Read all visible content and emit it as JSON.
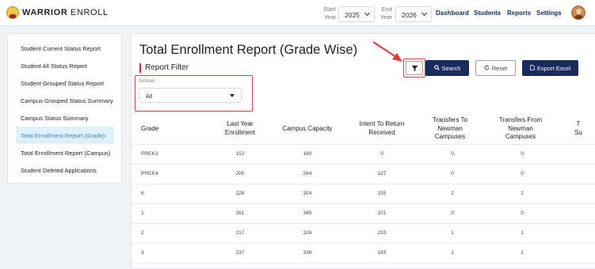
{
  "brand": {
    "bold": "WARRIOR",
    "rest": " ENROLL"
  },
  "year_filter": {
    "start_label_1": "Start",
    "start_label_2": "Year",
    "start_value": "2025",
    "end_label_1": "End",
    "end_label_2": "Year",
    "end_value": "2026"
  },
  "nav": [
    "Dashboard",
    "Students",
    "Reports",
    "Settings"
  ],
  "sidebar": {
    "items": [
      {
        "label": "Student Current Status Report"
      },
      {
        "label": "Student All Status Report"
      },
      {
        "label": "Student Grouped Status Report"
      },
      {
        "label": "Campus Grouped Status Summary"
      },
      {
        "label": "Campus Status Summary"
      },
      {
        "label": "Total Enrollment Report (Grade)",
        "active": true
      },
      {
        "label": "Total Enrollment Report (Campus)"
      },
      {
        "label": "Student Deleted Applications"
      }
    ]
  },
  "main": {
    "title": "Total Enrollment Report (Grade Wise)",
    "filter_heading": "Report Filter",
    "buttons": {
      "search": "Search",
      "reset": "Reset",
      "export": "Export Excel"
    },
    "school": {
      "label": "School",
      "value": "All"
    }
  },
  "table": {
    "headers": [
      [
        "Grade"
      ],
      [
        "Last Year",
        "Enrollment"
      ],
      [
        "Campus Capacity"
      ],
      [
        "Intent To Return",
        "Received"
      ],
      [
        "Transfers To",
        "Newman",
        "Campuses"
      ],
      [
        "Transfers From",
        "Newman",
        "Campuses"
      ],
      [
        "T",
        "Su"
      ]
    ],
    "rows": [
      [
        "PREK3",
        "152",
        "180",
        "0",
        "0",
        "0"
      ],
      [
        "PREK4",
        "200",
        "264",
        "127",
        "0",
        "0"
      ],
      [
        "K",
        "228",
        "324",
        "155",
        "2",
        "2"
      ],
      [
        "1",
        "261",
        "345",
        "201",
        "0",
        "0"
      ],
      [
        "2",
        "217",
        "326",
        "233",
        "1",
        "1"
      ],
      [
        "3",
        "237",
        "336",
        "183",
        "1",
        "1"
      ]
    ]
  },
  "colors": {
    "navy": "#1b2a5c",
    "active_bg": "#dff0fb",
    "active_text": "#3a83c9",
    "highlight": "#e53935",
    "accent_bar": "#d1294b"
  },
  "icons": [
    "logo-icon",
    "chevron-down-icon",
    "avatar",
    "filter-icon",
    "search-icon",
    "refresh-icon",
    "excel-icon",
    "caret-down-icon",
    "annotation-arrow"
  ]
}
